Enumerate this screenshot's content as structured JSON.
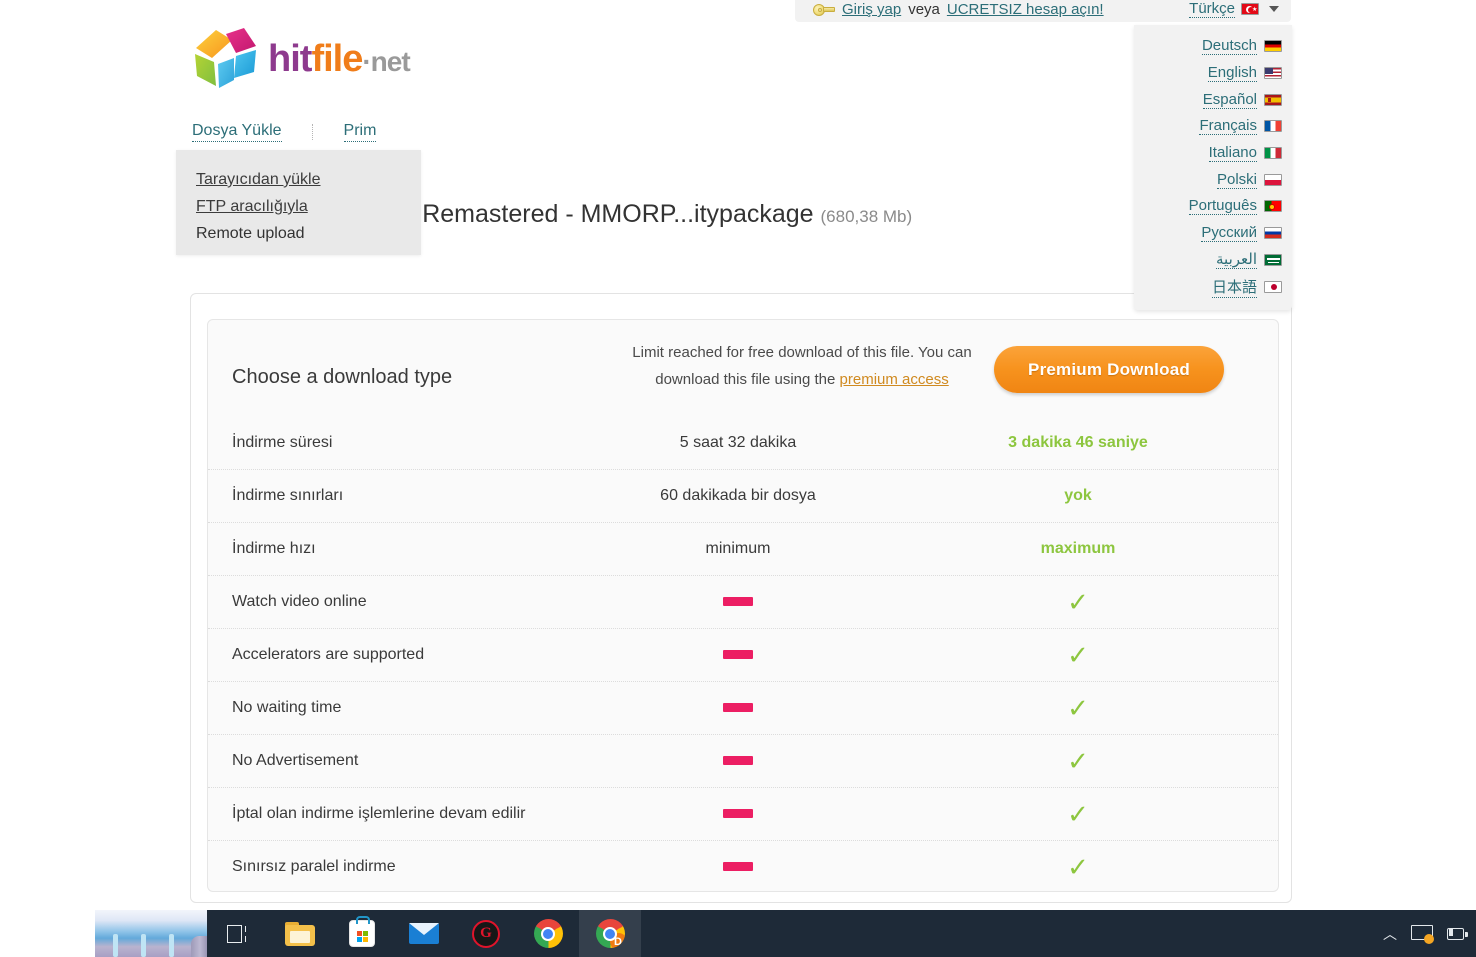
{
  "topbar": {
    "key_icon": "key-icon",
    "login_label": "Giriş yap",
    "or_label": "veya",
    "register_label": "UCRETSIZ hesap açın!",
    "current_language": "Türkçe",
    "current_flag": "flag-tr"
  },
  "language_menu": [
    {
      "label": "Deutsch",
      "flag": "flag-de"
    },
    {
      "label": "English",
      "flag": "flag-us"
    },
    {
      "label": "Español",
      "flag": "flag-es"
    },
    {
      "label": "Français",
      "flag": "flag-fr"
    },
    {
      "label": "Italiano",
      "flag": "flag-it"
    },
    {
      "label": "Polski",
      "flag": "flag-pl"
    },
    {
      "label": "Português",
      "flag": "flag-pt"
    },
    {
      "label": "Русский",
      "flag": "flag-ru"
    },
    {
      "label": "العربية",
      "flag": "flag-sa"
    },
    {
      "label": "日本語",
      "flag": "flag-jp"
    }
  ],
  "logo": {
    "part1": "hit",
    "part2": "file",
    "part3": "·net"
  },
  "nav": {
    "upload_label": "Dosya Yükle",
    "premium_label": "Prim"
  },
  "upload_menu": [
    {
      "label": "Tarayıcıdan yükle",
      "link": true
    },
    {
      "label": "FTP aracılığıyla",
      "link": true
    },
    {
      "label": "Remote upload",
      "link": false
    }
  ],
  "file": {
    "name": "MMORPG Remastered - MMORP...itypackage",
    "size": "(680,38 Mb)"
  },
  "download": {
    "title": "Choose a download type",
    "note_line1": "Limit reached for free download of this file.",
    "note_line2_pre": "You can download this file using the ",
    "note_link": "premium access",
    "button_label": "Premium Download",
    "button_color": "#f7931e"
  },
  "comparison": {
    "accent_green": "#8dc63f",
    "accent_pink": "#ec1e63",
    "rows": [
      {
        "label": "İndirme süresi",
        "free": "5 saat 32 dakika",
        "premium": "3 dakika 46 saniye",
        "type": "text"
      },
      {
        "label": "İndirme sınırları",
        "free": "60 dakikada bir dosya",
        "premium": "yok",
        "type": "text"
      },
      {
        "label": "İndirme hızı",
        "free": "minimum",
        "premium": "maximum",
        "type": "text"
      },
      {
        "label": "Watch video online",
        "free": "—",
        "premium": "✔",
        "type": "icon"
      },
      {
        "label": "Accelerators are supported",
        "free": "—",
        "premium": "✔",
        "type": "icon"
      },
      {
        "label": "No waiting time",
        "free": "—",
        "premium": "✔",
        "type": "icon"
      },
      {
        "label": "No Advertisement",
        "free": "—",
        "premium": "✔",
        "type": "icon"
      },
      {
        "label": "İptal olan indirme işlemlerine devam edilir",
        "free": "—",
        "premium": "✔",
        "type": "icon"
      },
      {
        "label": "Sınırsız paralel indirme",
        "free": "—",
        "premium": "✔",
        "type": "icon"
      }
    ]
  },
  "taskbar": {
    "items": [
      {
        "name": "task-view-icon"
      },
      {
        "name": "file-explorer-icon"
      },
      {
        "name": "microsoft-store-icon"
      },
      {
        "name": "mail-icon"
      },
      {
        "name": "antivirus-icon"
      },
      {
        "name": "chrome-icon"
      },
      {
        "name": "chrome-download-icon"
      }
    ],
    "tray": [
      {
        "name": "show-hidden-icons-chevron"
      },
      {
        "name": "network-icon"
      },
      {
        "name": "battery-icon"
      }
    ]
  }
}
